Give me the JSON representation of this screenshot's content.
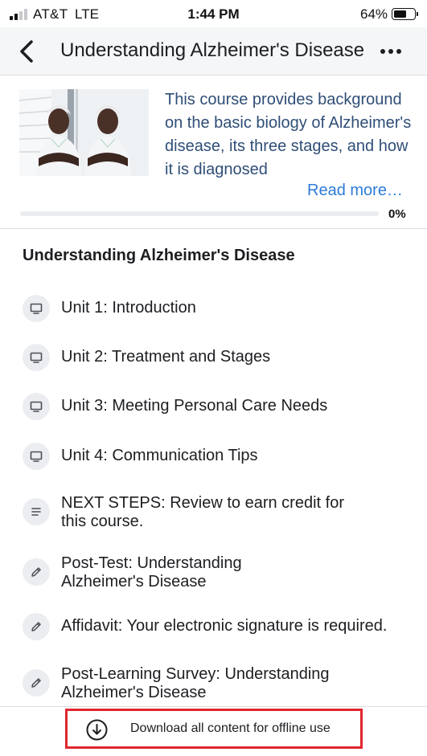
{
  "status_bar": {
    "carrier": "AT&T",
    "network": "LTE",
    "time": "1:44 PM",
    "battery_percent": "64%",
    "battery_level": 0.64,
    "signal_bars": 2
  },
  "nav": {
    "title": "Understanding Alzheimer's Disease",
    "back_icon": "chevron-left-icon",
    "more_icon": "more-horizontal-icon"
  },
  "course": {
    "description": "This course provides background on the basic biology of Alzheimer's disease, its three stages, and how it is diagnosed",
    "read_more": "Read more…",
    "progress_label": "0%",
    "progress_value": 0
  },
  "section": {
    "title": "Understanding Alzheimer's Disease"
  },
  "units": [
    {
      "label": "Unit 1: Introduction",
      "icon": "monitor-icon"
    },
    {
      "label": "Unit 2: Treatment and Stages",
      "icon": "monitor-icon"
    },
    {
      "label": "Unit 3: Meeting Personal Care Needs",
      "icon": "monitor-icon"
    },
    {
      "label": "Unit 4: Communication Tips",
      "icon": "monitor-icon"
    },
    {
      "label": "NEXT STEPS: Review to earn credit for this course.",
      "icon": "text-lines-icon"
    },
    {
      "label": "Post-Test: Understanding Alzheimer's Disease",
      "icon": "pencil-icon"
    },
    {
      "label": "Affidavit: Your electronic signature is required.",
      "icon": "pencil-icon"
    },
    {
      "label": "Post-Learning Survey: Understanding Alzheimer's Disease",
      "icon": "pencil-icon"
    }
  ],
  "footer": {
    "download_label": "Download all content for offline use",
    "download_icon": "download-circle-icon"
  },
  "colors": {
    "accent": "#1877f2",
    "link": "#2d7bd8",
    "description_text": "#2f4e77",
    "highlight_border": "#e0262f"
  }
}
